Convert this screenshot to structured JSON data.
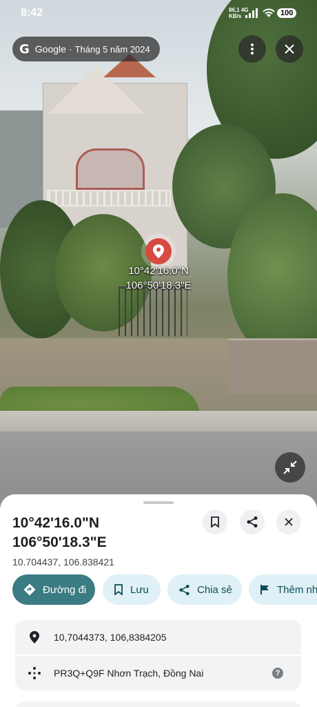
{
  "status_bar": {
    "time": "8:42",
    "network_speed": "86,1",
    "network_unit": "KB/s",
    "network_type": "4G",
    "battery": "100"
  },
  "overlay": {
    "brand": "Google",
    "separator": "·",
    "capture_date": "Tháng 5 năm 2024",
    "pin_lat": "10°42'16.0\"N",
    "pin_lng": "106°50'18.3\"E"
  },
  "sheet": {
    "title_lat": "10°42'16.0\"N",
    "title_lng": "106°50'18.3\"E",
    "decimal_coords": "10.704437, 106.838421",
    "actions": {
      "directions": "Đường đi",
      "save": "Lưu",
      "share": "Chia sẻ",
      "more": "Thêm nh"
    },
    "coords_row": "10,7044373, 106,8384205",
    "plus_code_row": "PR3Q+Q9F Nhơn Trạch, Đồng Nai",
    "help_glyph": "?"
  },
  "colors": {
    "primary": "#3b7b82",
    "secondary_bg": "#dff1f6",
    "pin": "#d64a42"
  },
  "icons": [
    "google-g-icon",
    "more-vert-icon",
    "close-icon",
    "collapse-icon",
    "pin-icon",
    "bookmark-icon",
    "share-icon",
    "directions-icon",
    "flag-icon",
    "location-icon",
    "plus-code-icon",
    "help-icon"
  ]
}
